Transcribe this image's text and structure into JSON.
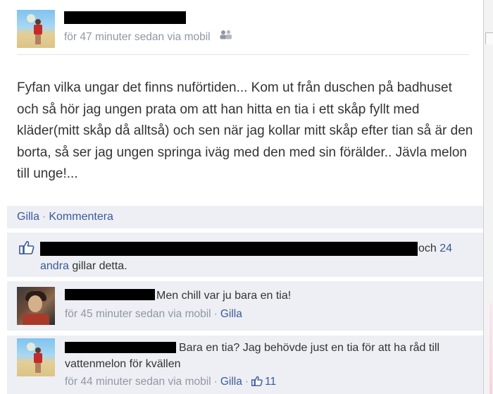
{
  "post": {
    "meta": "för 47 minuter sedan via mobil",
    "audience_icon": "friends-icon",
    "body": "Fyfan vilka ungar det finns nuförtiden... Kom ut från duschen på badhuset och så hör jag ungen prata om att han hitta en tia i ett skåp fyllt med kläder(mitt skåp då alltså) och sen när jag kollar mitt skåp efter tian så är den borta, så ser jag ungen springa iväg med den med sin förälder.. Jävla melon till unge!..."
  },
  "actions": {
    "like_label": "Gilla",
    "separator": "·",
    "comment_label": "Kommentera"
  },
  "likes": {
    "icon": "thumbs-up-icon",
    "suffix_plain": "och",
    "others_link_part1": "24",
    "others_link_part2": "andra",
    "tail": "gillar detta."
  },
  "comments": [
    {
      "text": "Men chill var ju bara en tia!",
      "meta": "för 45 minuter sedan via mobil",
      "like_label": "Gilla"
    },
    {
      "text": "Bara en tia? Jag behövde just en tia för att ha råd till vattenmelon för kvällen",
      "meta": "för 44 minuter sedan via mobil",
      "like_label": "Gilla",
      "like_count": "11"
    }
  ],
  "colors": {
    "link": "#3b5998",
    "meta": "#9197a3",
    "panel": "#edeff4"
  }
}
